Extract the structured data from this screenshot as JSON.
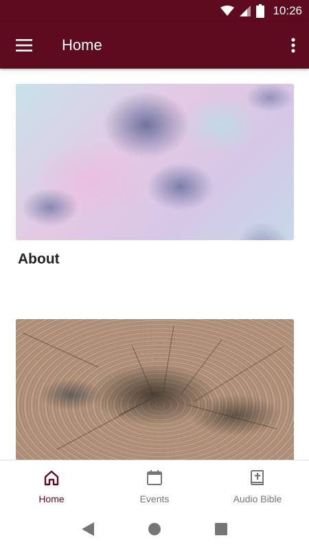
{
  "status_bar": {
    "time": "10:26",
    "icons": [
      "wifi-icon",
      "cell-signal-icon",
      "battery-icon"
    ]
  },
  "app_bar": {
    "title": "Home",
    "menu_icon": "hamburger-menu-icon",
    "more_icon": "more-vert-icon"
  },
  "cards": [
    {
      "label": "About",
      "image": "pastel-clouds-sky"
    },
    {
      "label": "",
      "image": "tree-rings-wood"
    }
  ],
  "bottom_nav": {
    "items": [
      {
        "label": "Home",
        "icon": "home-icon",
        "active": true
      },
      {
        "label": "Events",
        "icon": "calendar-icon",
        "active": false
      },
      {
        "label": "Audio Bible",
        "icon": "bible-icon",
        "active": false
      }
    ]
  },
  "system_nav": {
    "icons": [
      "back-icon",
      "home-circle-icon",
      "recents-icon"
    ]
  },
  "colors": {
    "primary": "#5e0a1f",
    "inactive": "#757575",
    "background": "#ffffff"
  }
}
